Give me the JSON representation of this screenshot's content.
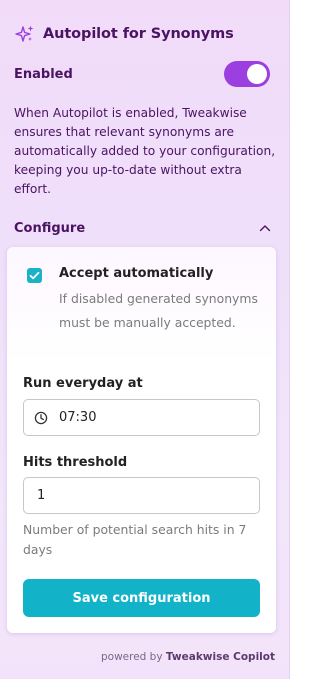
{
  "header": {
    "icon": "sparkles-icon",
    "title": "Autopilot for Synonyms"
  },
  "enabled": {
    "label": "Enabled",
    "toggle_on": true,
    "toggle_color": "#9b3fe0"
  },
  "description": "When Autopilot is enabled, Tweakwise ensures that relevant synonyms are automatically added to your configuration, keeping you up-to-date without extra effort.",
  "configure": {
    "label": "Configure",
    "expanded": true,
    "chevron_icon": "chevron-up-icon",
    "accept": {
      "label": "Accept automatically",
      "checked": true,
      "help": "If disabled generated synonyms must be manually accepted."
    },
    "schedule": {
      "label": "Run everyday at",
      "icon": "clock-icon",
      "value": "07:30"
    },
    "threshold": {
      "label": "Hits threshold",
      "value": "1",
      "hint": "Number of potential search hits in 7 days"
    },
    "save_label": "Save configuration",
    "accent_color": "#12b3c8"
  },
  "footer": {
    "prefix": "powered by",
    "brand": "Tweakwise Copilot"
  }
}
